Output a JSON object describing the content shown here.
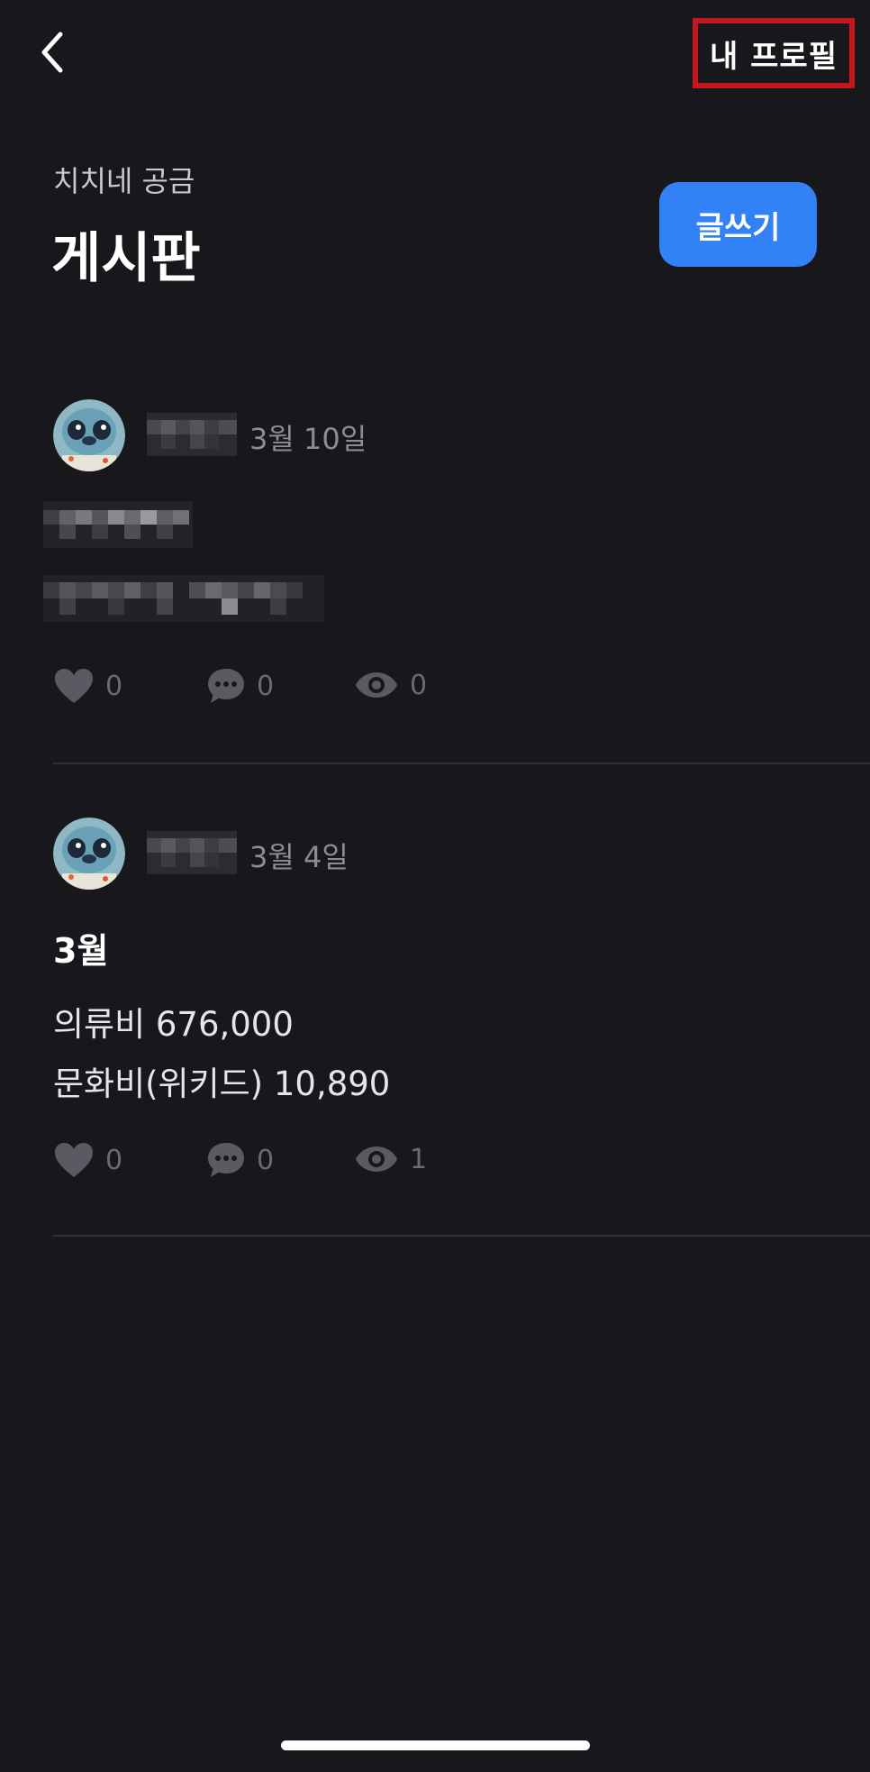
{
  "header": {
    "back_icon": "chevron-left-icon",
    "profile_label": "내 프로필",
    "subtitle": "치치네 공금",
    "title": "게시판",
    "write_label": "글쓰기"
  },
  "posts": [
    {
      "date": "3월 10일",
      "heading": "",
      "body": [],
      "likes": "0",
      "comments": "0",
      "views": "0"
    },
    {
      "date": "3월 4일",
      "heading": "3월",
      "body": [
        "의류비 676,000",
        "문화비(위키드) 10,890"
      ],
      "likes": "0",
      "comments": "0",
      "views": "1"
    }
  ],
  "colors": {
    "background": "#18171c",
    "accent": "#3281f7",
    "highlight_border": "#c4161c",
    "muted": "#6a6a72"
  }
}
